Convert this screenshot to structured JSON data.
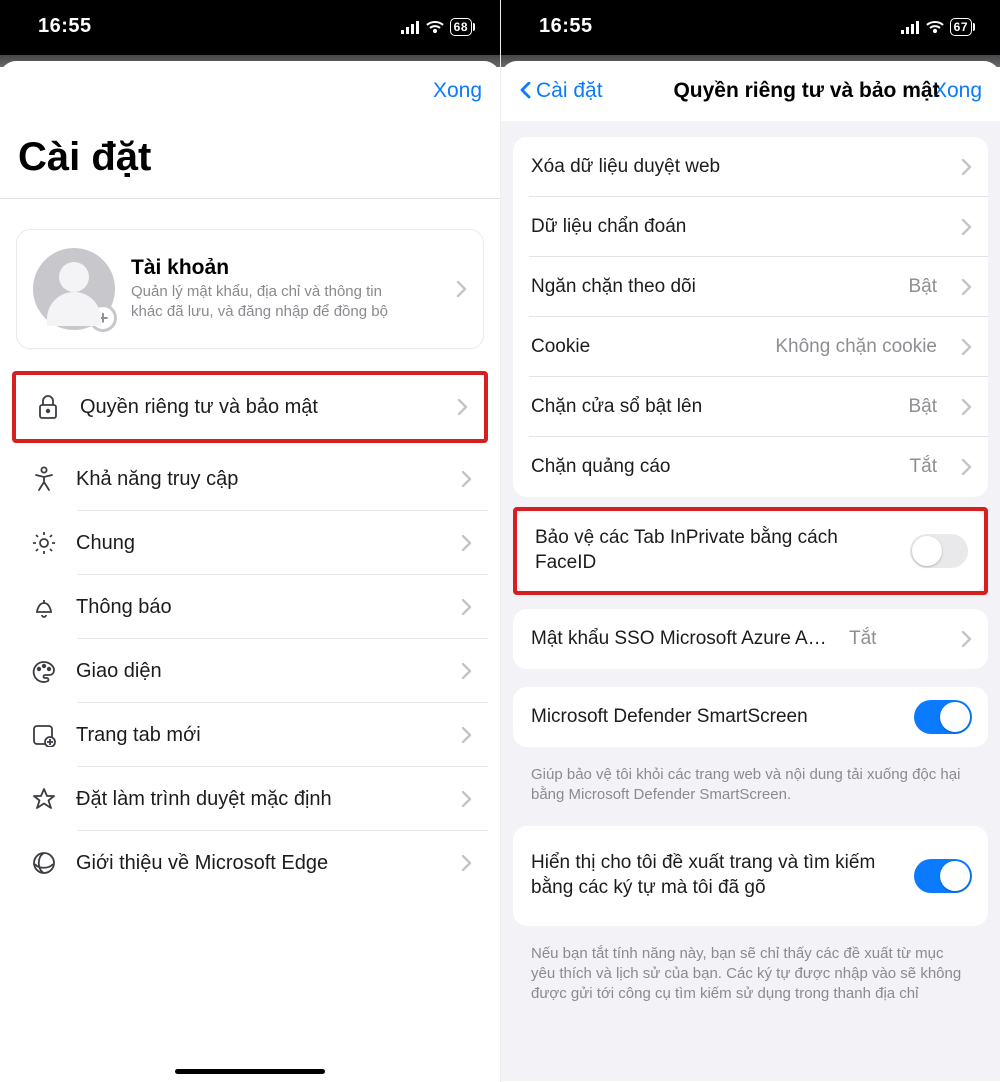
{
  "left": {
    "status": {
      "time": "16:55",
      "battery": "68"
    },
    "nav": {
      "done": "Xong"
    },
    "title": "Cài đặt",
    "account": {
      "title": "Tài khoản",
      "subtitle": "Quản lý mật khẩu, địa chỉ và thông tin khác đã lưu, và đăng nhập để đồng bộ"
    },
    "rows": [
      {
        "label": "Quyền riêng tư và bảo mật"
      },
      {
        "label": "Khả năng truy cập"
      },
      {
        "label": "Chung"
      },
      {
        "label": "Thông báo"
      },
      {
        "label": "Giao diện"
      },
      {
        "label": "Trang tab mới"
      },
      {
        "label": "Đặt làm trình duyệt mặc định"
      },
      {
        "label": "Giới thiệu về Microsoft Edge"
      }
    ]
  },
  "right": {
    "status": {
      "time": "16:55",
      "battery": "67"
    },
    "nav": {
      "back": "Cài đặt",
      "title": "Quyền riêng tư và bảo mật",
      "done": "Xong"
    },
    "g1": [
      {
        "label": "Xóa dữ liệu duyệt web"
      },
      {
        "label": "Dữ liệu chẩn đoán"
      },
      {
        "label": "Ngăn chặn theo dõi",
        "value": "Bật"
      },
      {
        "label": "Cookie",
        "value": "Không chặn cookie"
      },
      {
        "label": "Chặn cửa sổ bật lên",
        "value": "Bật"
      },
      {
        "label": "Chặn quảng cáo",
        "value": "Tắt"
      }
    ],
    "faceid": {
      "label": "Bảo vệ các Tab InPrivate bằng cách FaceID"
    },
    "sso": {
      "label": "Mật khẩu SSO Microsoft Azure Ac...",
      "value": "Tắt"
    },
    "defender": {
      "label": "Microsoft Defender SmartScreen"
    },
    "defender_note": "Giúp bảo vệ tôi khỏi các trang web và nội dung tải xuống độc hại bằng Microsoft Defender SmartScreen.",
    "suggest": {
      "label": "Hiển thị cho tôi đề xuất trang và tìm kiếm bằng các ký tự mà tôi đã gõ"
    },
    "suggest_note": "Nếu bạn tắt tính năng này, bạn sẽ chỉ thấy các đề xuất từ mục yêu thích và lịch sử của bạn. Các ký tự được nhập vào sẽ không được gửi tới công cụ tìm kiếm sử dụng trong thanh địa chỉ"
  }
}
